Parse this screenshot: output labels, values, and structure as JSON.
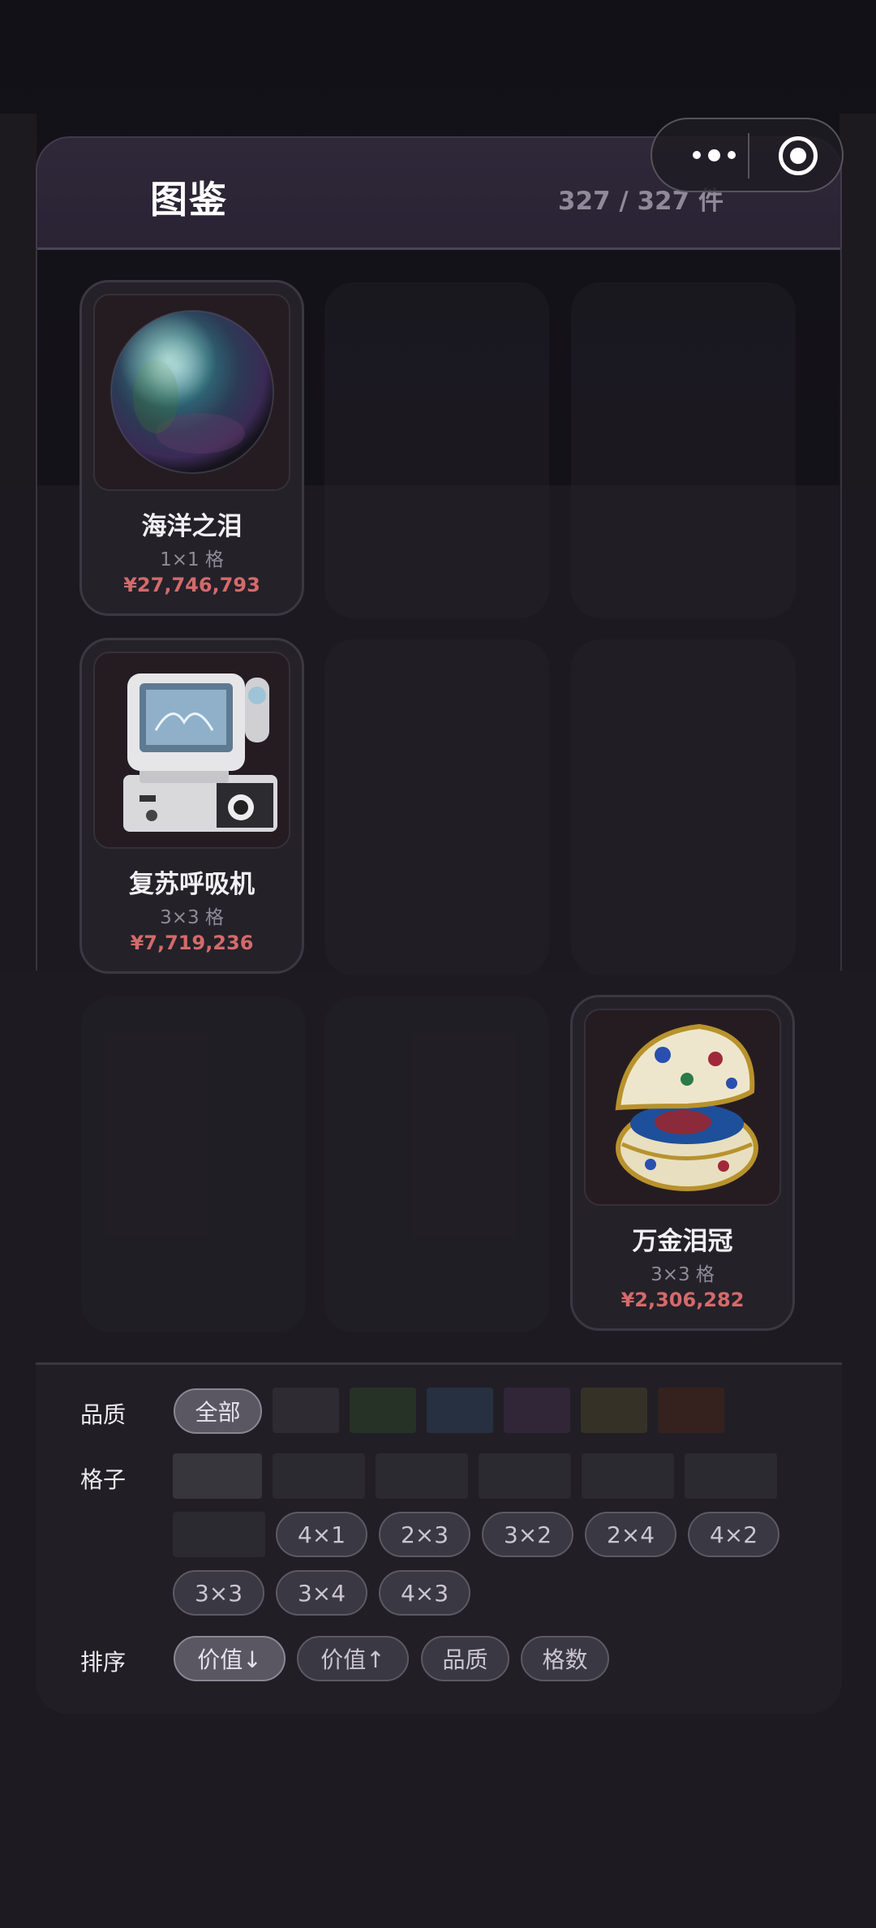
{
  "header": {
    "title": "图鉴",
    "count": "327 / 327 件"
  },
  "capsule": {
    "more_icon": "more-dots-icon",
    "close_icon": "target-circle-icon"
  },
  "items": [
    {
      "name": "海洋之泪",
      "size": "1×1 格",
      "price": "¥27,746,793",
      "image": "iridescent-pearl-sphere"
    },
    {
      "name": "复苏呼吸机",
      "size": "3×3 格",
      "price": "¥7,719,236",
      "image": "medical-ventilator-machine"
    },
    {
      "name": "万金泪冠",
      "size": "3×3 格",
      "price": "¥2,306,282",
      "image": "jeweled-faberge-egg"
    }
  ],
  "filters": {
    "quality_label": "品质",
    "quality_options": [
      "全部"
    ],
    "quality_swatch_colors": [
      "#2e2c32",
      "#263226",
      "#263040",
      "#302638",
      "#363126",
      "#35221f"
    ],
    "grid_label": "格子",
    "grid_options": [
      "4×1",
      "2×3",
      "3×2",
      "2×4",
      "4×2",
      "3×3",
      "3×4",
      "4×3"
    ],
    "sort_label": "排序",
    "sort_options": [
      "价值↓",
      "价值↑",
      "品质",
      "格数"
    ],
    "active_quality": "全部",
    "active_sort": "价值↓"
  }
}
